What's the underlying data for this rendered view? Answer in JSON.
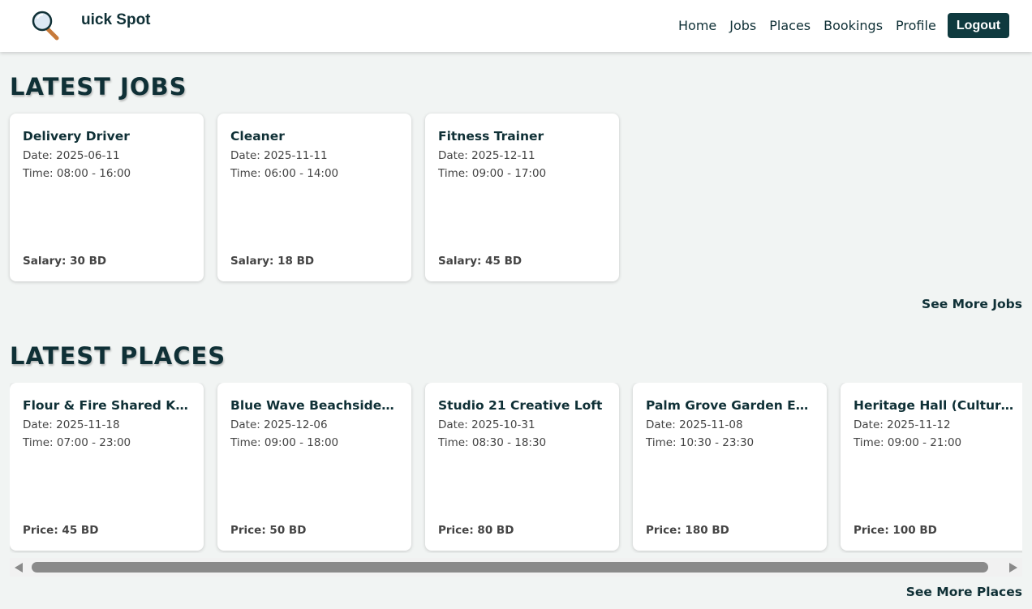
{
  "header": {
    "logo_text": "uick Spot",
    "nav": [
      "Home",
      "Jobs",
      "Places",
      "Bookings",
      "Profile"
    ],
    "logout_label": "Logout"
  },
  "jobs_section": {
    "title": "LATEST JOBS",
    "see_more": "See More Jobs",
    "cards": [
      {
        "title": "Delivery Driver",
        "date": "Date: 2025-06-11",
        "time": "Time: 08:00 - 16:00",
        "bottom": "Salary: 30 BD"
      },
      {
        "title": "Cleaner",
        "date": "Date: 2025-11-11",
        "time": "Time: 06:00 - 14:00",
        "bottom": "Salary: 18 BD"
      },
      {
        "title": "Fitness Trainer",
        "date": "Date: 2025-12-11",
        "time": "Time: 09:00 - 17:00",
        "bottom": "Salary: 45 BD"
      }
    ]
  },
  "places_section": {
    "title": "LATEST PLACES",
    "see_more": "See More Places",
    "cards": [
      {
        "title": "Flour & Fire Shared Kitchen",
        "date": "Date: 2025-11-18",
        "time": "Time: 07:00 - 23:00",
        "bottom": "Price: 45 BD"
      },
      {
        "title": "Blue Wave Beachside Pavil...",
        "date": "Date: 2025-12-06",
        "time": "Time: 09:00 - 18:00",
        "bottom": "Price: 50 BD"
      },
      {
        "title": "Studio 21 Creative Loft",
        "date": "Date: 2025-10-31",
        "time": "Time: 08:30 - 18:30",
        "bottom": "Price: 80 BD"
      },
      {
        "title": "Palm Grove Garden Event ...",
        "date": "Date: 2025-11-08",
        "time": "Time: 10:30 - 23:30",
        "bottom": "Price: 180 BD"
      },
      {
        "title": "Heritage Hall (Cultural Ve...",
        "date": "Date: 2025-11-12",
        "time": "Time: 09:00 - 21:00",
        "bottom": "Price: 100 BD"
      }
    ]
  }
}
